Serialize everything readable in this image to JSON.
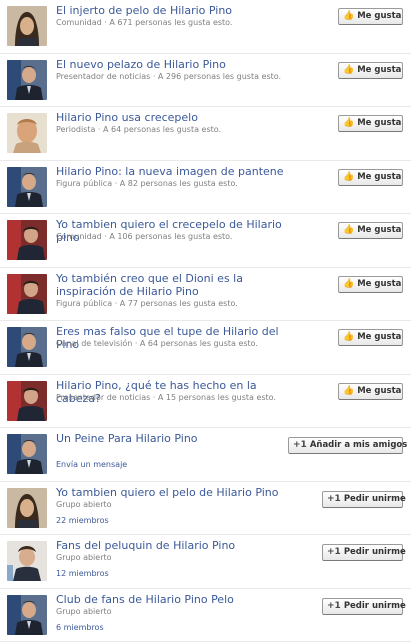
{
  "rows": [
    {
      "title": "El injerto de pelo de Hilario Pino",
      "sub": "Comunidad · A 671 personas les gusta esto.",
      "button": "Me gusta",
      "btn_icon": "thumbs-up-icon",
      "extra": "",
      "kind": "like",
      "thumb": "a"
    },
    {
      "title": "El nuevo pelazo de Hilario Pino",
      "sub": "Presentador de noticias · A 296 personas les gusta esto.",
      "button": "Me gusta",
      "btn_icon": "thumbs-up-icon",
      "extra": "",
      "kind": "like",
      "thumb": "b"
    },
    {
      "title": "Hilario Pino usa crecepelo",
      "sub": "Periodista · A 64 personas les gusta esto.",
      "button": "Me gusta",
      "btn_icon": "thumbs-up-icon",
      "extra": "",
      "kind": "like",
      "thumb": "c"
    },
    {
      "title": "Hilario Pino: la nueva imagen de pantene",
      "sub": "Figura pública · A 82 personas les gusta esto.",
      "button": "Me gusta",
      "btn_icon": "thumbs-up-icon",
      "extra": "",
      "kind": "like",
      "thumb": "b"
    },
    {
      "title": "Yo tambien quiero el crecepelo de Hilario pino",
      "sub": "Comunidad · A 106 personas les gusta esto.",
      "button": "Me gusta",
      "btn_icon": "thumbs-up-icon",
      "extra": "",
      "kind": "like",
      "thumb": "d"
    },
    {
      "title": "Yo también creo que el Dioni es la inspiración de Hilario Pino",
      "sub": "Figura pública · A 77 personas les gusta esto.",
      "button": "Me gusta",
      "btn_icon": "thumbs-up-icon",
      "extra": "",
      "kind": "like",
      "thumb": "d"
    },
    {
      "title": "Eres mas falso que el tupe de Hilario del Pino",
      "sub": "Canal de televisión · A 64 personas les gusta esto.",
      "button": "Me gusta",
      "btn_icon": "thumbs-up-icon",
      "extra": "",
      "kind": "like",
      "thumb": "b"
    },
    {
      "title": "Hilario Pino, ¿qué te has hecho en la cabeza?",
      "sub": "Presentador de noticias · A 15 personas les gusta esto.",
      "button": "Me gusta",
      "btn_icon": "thumbs-up-icon",
      "extra": "",
      "kind": "like",
      "thumb": "d"
    },
    {
      "title": "Un Peine Para Hilario Pino",
      "sub": "",
      "button": "Añadir a mis amigos",
      "btn_icon": "add-friend-icon",
      "extra": "Envía un mensaje",
      "kind": "add",
      "thumb": "b"
    },
    {
      "title": "Yo tambien quiero el pelo de Hilario Pino",
      "sub": "Grupo abierto",
      "button": "Pedir unirme",
      "btn_icon": "add-icon",
      "extra": "22 miembros",
      "kind": "join",
      "thumb": "a"
    },
    {
      "title": "Fans del peluquin de Hilario Pino",
      "sub": "Grupo abierto",
      "button": "Pedir unirme",
      "btn_icon": "add-icon",
      "extra": "12 miembros",
      "kind": "join",
      "thumb": "e"
    },
    {
      "title": "Club de fans de Hilario Pino Pelo",
      "sub": "Grupo abierto",
      "button": "Pedir unirme",
      "btn_icon": "add-icon",
      "extra": "6 miembros",
      "kind": "join",
      "thumb": "b"
    }
  ],
  "colors": {
    "link": "#3b5998",
    "meta": "#808080",
    "divider": "#e9e9e9"
  }
}
